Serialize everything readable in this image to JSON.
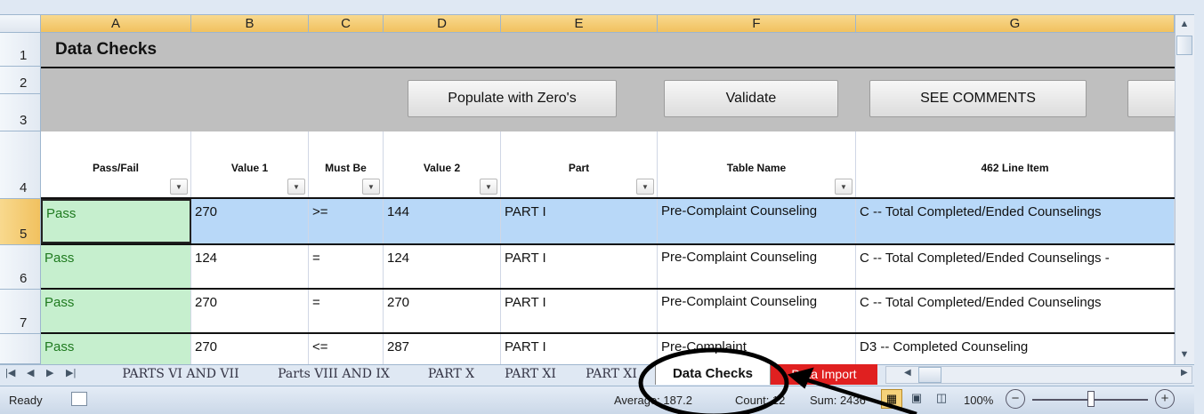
{
  "sheet": {
    "columns": [
      "A",
      "B",
      "C",
      "D",
      "E",
      "F",
      "G"
    ],
    "rows": [
      "1",
      "2",
      "3",
      "4",
      "5",
      "6",
      "7"
    ],
    "title": "Data Checks",
    "buttons": {
      "populate": "Populate with Zero's",
      "validate": "Validate",
      "comments": "SEE COMMENTS"
    },
    "headers": [
      "Pass/Fail",
      "Value 1",
      "Must Be",
      "Value 2",
      "Part",
      "Table Name",
      "462 Line Item"
    ],
    "data": [
      {
        "row": "5",
        "pass": "Pass",
        "v1": "270",
        "op": ">=",
        "v2": "144",
        "part": "PART I",
        "table": "Pre-Complaint Counseling",
        "item": "C -- Total Completed/Ended Counselings"
      },
      {
        "row": "6",
        "pass": "Pass",
        "v1": "124",
        "op": "=",
        "v2": "124",
        "part": "PART I",
        "table": "Pre-Complaint Counseling",
        "item": "C -- Total Completed/Ended Counselings -"
      },
      {
        "row": "7",
        "pass": "Pass",
        "v1": "270",
        "op": "=",
        "v2": "270",
        "part": "PART I",
        "table": "Pre-Complaint Counseling",
        "item": "C -- Total Completed/Ended Counselings"
      },
      {
        "row": "",
        "pass": "Pass",
        "v1": "270",
        "op": "<=",
        "v2": "287",
        "part": "PART I",
        "table": "Pre-Complaint",
        "item": "D3 -- Completed Counseling"
      }
    ]
  },
  "tabs": {
    "items": [
      "PARTS VI AND VII",
      "Parts VIII AND IX",
      "PART X",
      "PART XI",
      "PART XI"
    ],
    "active": "Data Checks",
    "red": "Data Import"
  },
  "status": {
    "ready": "Ready",
    "average": "Average: 187.2",
    "count": "Count: 12",
    "sum": "Sum: 2436",
    "zoom": "100%"
  },
  "colors": {
    "selected": "#b8d8f8",
    "pass": "#c6efce",
    "header": "#bfbfbf",
    "active_tab": "#ffffff",
    "red_tab": "#e02020"
  }
}
